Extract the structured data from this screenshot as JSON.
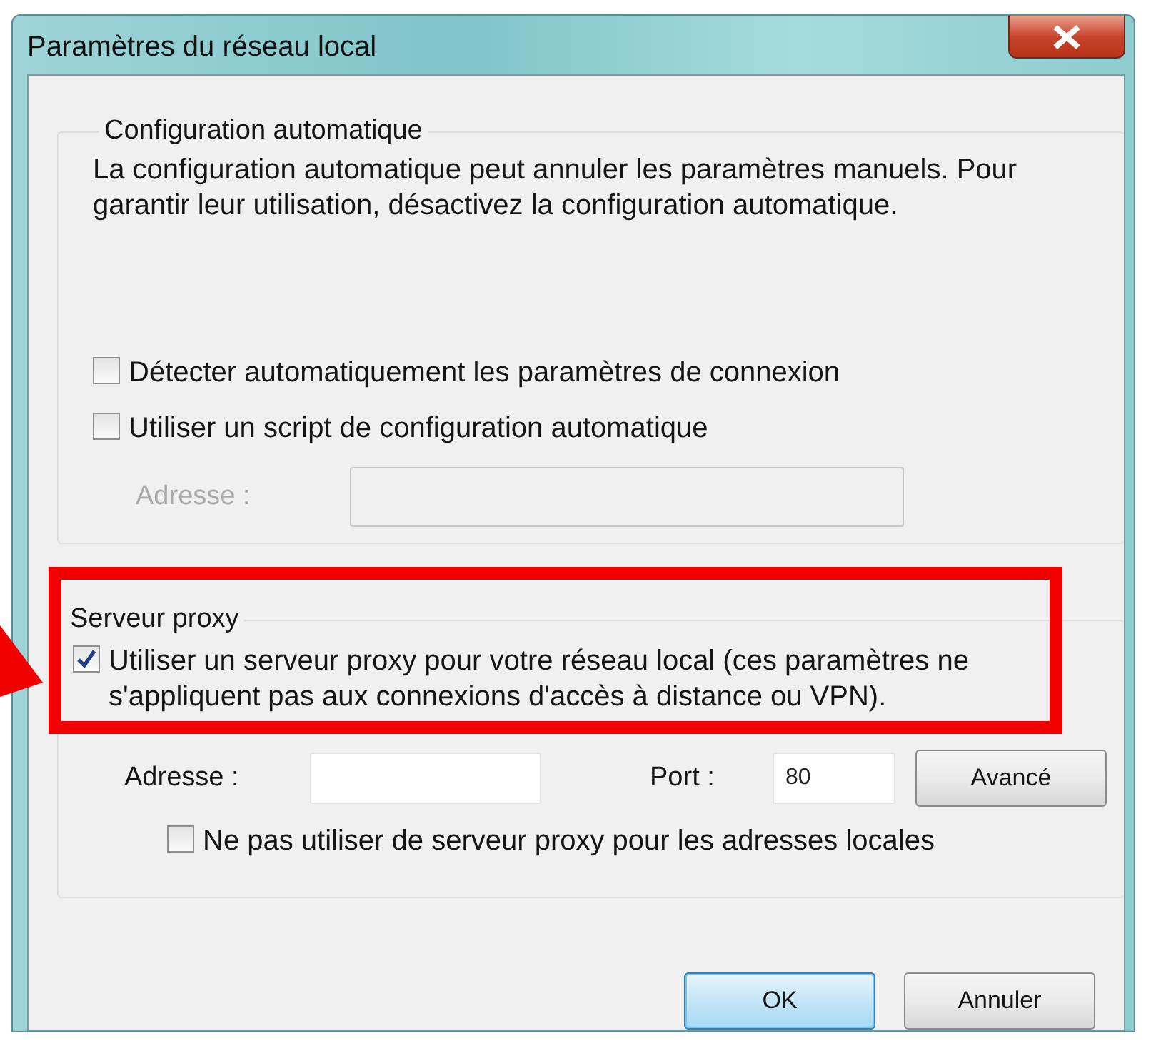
{
  "window": {
    "title": "Paramètres du réseau local"
  },
  "auto_config": {
    "title": "Configuration automatique",
    "description": "La configuration automatique peut annuler les paramètres manuels. Pour garantir leur utilisation, désactivez la configuration automatique.",
    "options": [
      {
        "label": "Détecter automatiquement les paramètres de connexion",
        "checked": false
      },
      {
        "label": "Utiliser un script de configuration automatique",
        "checked": false
      }
    ],
    "address": {
      "label": "Adresse :",
      "disabled": true
    }
  },
  "proxy": {
    "title": "Serveur proxy",
    "highlighted": true,
    "use_proxy": {
      "label": "Utiliser un serveur proxy pour votre réseau local (ces paramètres ne s'appliquent pas aux connexions d'accès à distance ou VPN).",
      "checked": true
    },
    "address": {
      "label": "Adresse :"
    },
    "port": {
      "label": "Port :",
      "value": "80"
    },
    "advanced_button": "Avancé",
    "bypass_local": {
      "label": "Ne pas utiliser de serveur proxy pour les adresses locales",
      "checked": false
    }
  },
  "buttons": [
    {
      "label": "OK",
      "default": true
    },
    {
      "label": "Annuler",
      "default": false
    }
  ]
}
